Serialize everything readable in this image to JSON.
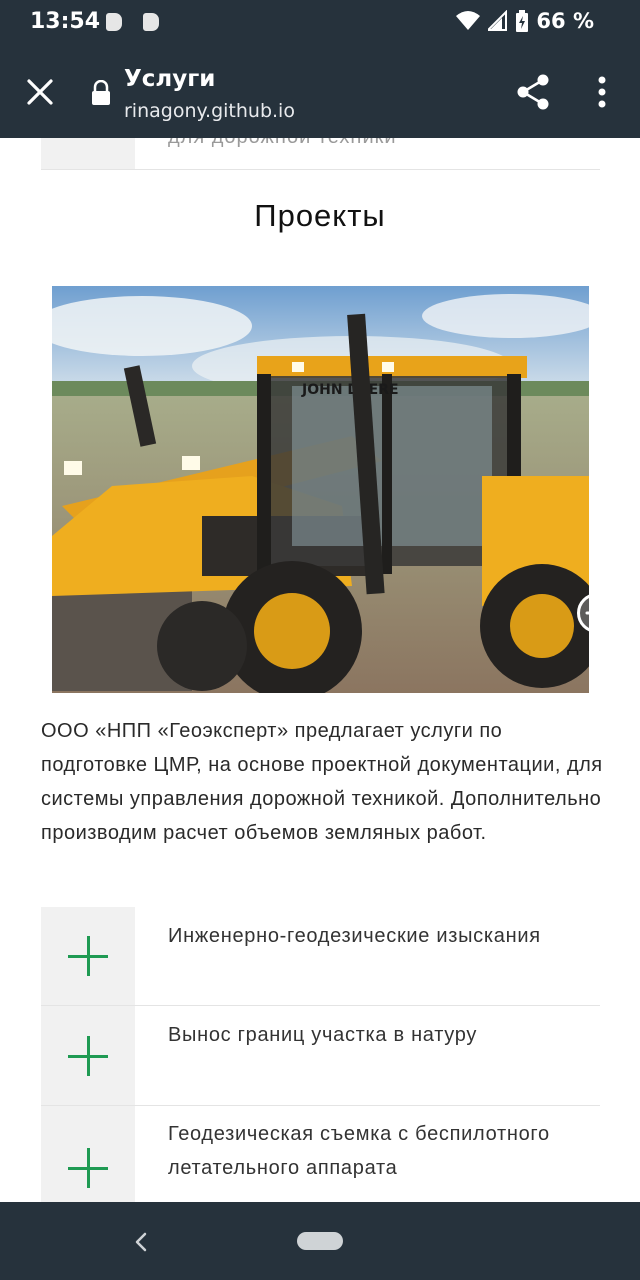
{
  "status_bar": {
    "time": "13:54",
    "battery": "66 %",
    "icons": [
      "notification-b-icon",
      "notification-b-icon",
      "wifi-icon",
      "signal-icon",
      "battery-charging-icon"
    ]
  },
  "toolbar": {
    "title": "Услуги",
    "url": "rinagony.github.io",
    "icons": [
      "close-icon",
      "lock-icon",
      "share-icon",
      "more-vert-icon"
    ]
  },
  "page": {
    "partial_text": "для дорожной техники",
    "section_title": "Проекты",
    "description": "ООО «НПП «Геоэксперт» предлагает услуги по подготовке ЦМР, на основе проектной документации, для системы управления дорожной техникой. Дополнительно производим расчет объемов земляных работ.",
    "accordion": [
      {
        "label": "Инженерно-геодезические изыскания"
      },
      {
        "label": "Вынос границ участка в натуру"
      },
      {
        "label": "Геодезическая съемка с беспилотного летательного аппарата"
      }
    ],
    "photo": {
      "brand_text": "JOHN DEERE",
      "carousel_icon": "arrow-right-icon"
    }
  },
  "colors": {
    "bar": "#26323c",
    "accent_plus": "#1f9a53",
    "accordion_square": "#f1f1f1"
  }
}
